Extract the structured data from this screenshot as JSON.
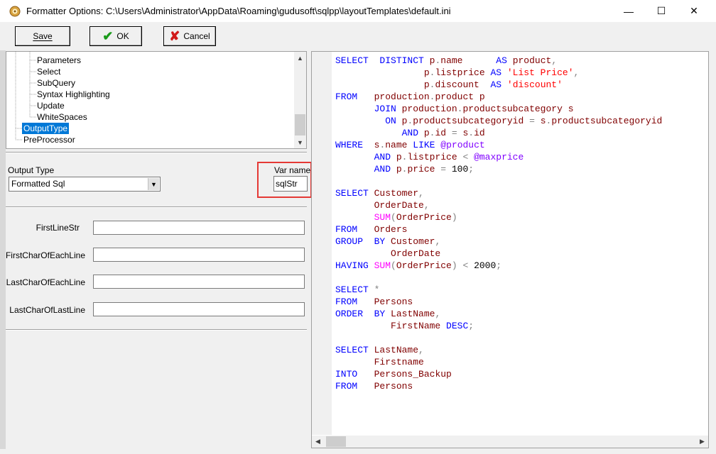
{
  "window": {
    "title": "Formatter Options: C:\\Users\\Administrator\\AppData\\Roaming\\gudusoft\\sqlpp\\layoutTemplates\\default.ini",
    "minimize_glyph": "—",
    "maximize_glyph": "☐",
    "close_glyph": "✕"
  },
  "toolbar": {
    "save_label": "Save",
    "ok_label": "OK",
    "cancel_label": "Cancel",
    "ok_glyph": "✔",
    "cancel_glyph": "✘"
  },
  "tree": {
    "items": [
      {
        "label": "Parameters",
        "selected": false
      },
      {
        "label": "Select",
        "selected": false
      },
      {
        "label": "SubQuery",
        "selected": false
      },
      {
        "label": "Syntax Highlighting",
        "selected": false
      },
      {
        "label": "Update",
        "selected": false
      },
      {
        "label": "WhiteSpaces",
        "selected": false
      },
      {
        "label": "OutputType",
        "selected": true
      },
      {
        "label": "PreProcessor",
        "selected": false
      }
    ]
  },
  "output": {
    "type_label": "Output Type",
    "type_value": "Formatted Sql",
    "varname_label": "Var name",
    "varname_value": "sqlStr"
  },
  "fields": [
    {
      "label": "FirstLineStr",
      "value": ""
    },
    {
      "label": "FirstCharOfEachLine",
      "value": ""
    },
    {
      "label": "LastCharOfEachLine",
      "value": ""
    },
    {
      "label": "LastCharOfLastLine",
      "value": ""
    }
  ],
  "colors": {
    "keyword": "#0000ff",
    "identifier": "#800000",
    "string": "#ff0000",
    "variable": "#8000ff",
    "function": "#ff00ff",
    "highlight_box": "#e53935",
    "selection": "#0078d7"
  },
  "editor": {
    "lines": [
      [
        [
          "kw",
          "SELECT"
        ],
        [
          "",
          "  "
        ],
        [
          "kw",
          "DISTINCT"
        ],
        [
          "",
          ""
        ],
        [
          "id",
          " p"
        ],
        [
          "op",
          "."
        ],
        [
          "id",
          "name"
        ],
        [
          "",
          "      "
        ],
        [
          "kw",
          "AS"
        ],
        [
          "id",
          " product"
        ],
        [
          "op",
          ","
        ]
      ],
      [
        [
          "",
          "                "
        ],
        [
          "id",
          "p"
        ],
        [
          "op",
          "."
        ],
        [
          "id",
          "listprice"
        ],
        [
          "",
          ""
        ],
        [
          "kw",
          " AS"
        ],
        [
          "str",
          " 'List Price'"
        ],
        [
          "op",
          ","
        ]
      ],
      [
        [
          "",
          "                "
        ],
        [
          "id",
          "p"
        ],
        [
          "op",
          "."
        ],
        [
          "id",
          "discount"
        ],
        [
          "",
          "  "
        ],
        [
          "kw",
          "AS"
        ],
        [
          "str",
          " 'discount'"
        ]
      ],
      [
        [
          "kw",
          "FROM"
        ],
        [
          "",
          "   "
        ],
        [
          "id",
          "production"
        ],
        [
          "op",
          "."
        ],
        [
          "id",
          "product"
        ],
        [
          "id",
          " p"
        ]
      ],
      [
        [
          "",
          "       "
        ],
        [
          "kw",
          "JOIN"
        ],
        [
          "id",
          " production"
        ],
        [
          "op",
          "."
        ],
        [
          "id",
          "productsubcategory"
        ],
        [
          "id",
          " s"
        ]
      ],
      [
        [
          "",
          "         "
        ],
        [
          "kw",
          "ON"
        ],
        [
          "id",
          " p"
        ],
        [
          "op",
          "."
        ],
        [
          "id",
          "productsubcategoryid"
        ],
        [
          "op",
          " = "
        ],
        [
          "id",
          "s"
        ],
        [
          "op",
          "."
        ],
        [
          "id",
          "productsubcategoryid"
        ]
      ],
      [
        [
          "",
          "            "
        ],
        [
          "kw",
          "AND"
        ],
        [
          "id",
          " p"
        ],
        [
          "op",
          "."
        ],
        [
          "id",
          "id"
        ],
        [
          "op",
          " = "
        ],
        [
          "id",
          "s"
        ],
        [
          "op",
          "."
        ],
        [
          "id",
          "id"
        ]
      ],
      [
        [
          "kw",
          "WHERE"
        ],
        [
          "",
          "  "
        ],
        [
          "id",
          "s"
        ],
        [
          "op",
          "."
        ],
        [
          "id",
          "name"
        ],
        [
          "kw",
          " LIKE"
        ],
        [
          "var",
          " @product"
        ]
      ],
      [
        [
          "",
          "       "
        ],
        [
          "kw",
          "AND"
        ],
        [
          "id",
          " p"
        ],
        [
          "op",
          "."
        ],
        [
          "id",
          "listprice"
        ],
        [
          "op",
          " < "
        ],
        [
          "var",
          "@maxprice"
        ]
      ],
      [
        [
          "",
          "       "
        ],
        [
          "kw",
          "AND"
        ],
        [
          "id",
          " p"
        ],
        [
          "op",
          "."
        ],
        [
          "id",
          "price"
        ],
        [
          "op",
          " = "
        ],
        [
          "num",
          "100"
        ],
        [
          "op",
          ";"
        ]
      ],
      [],
      [
        [
          "kw",
          "SELECT"
        ],
        [
          "id",
          " Customer"
        ],
        [
          "op",
          ","
        ]
      ],
      [
        [
          "",
          "       "
        ],
        [
          "id",
          "OrderDate"
        ],
        [
          "op",
          ","
        ]
      ],
      [
        [
          "",
          "       "
        ],
        [
          "fn",
          "SUM"
        ],
        [
          "op",
          "("
        ],
        [
          "id",
          "OrderPrice"
        ],
        [
          "op",
          ")"
        ]
      ],
      [
        [
          "kw",
          "FROM"
        ],
        [
          "",
          "   "
        ],
        [
          "id",
          "Orders"
        ]
      ],
      [
        [
          "kw",
          "GROUP"
        ],
        [
          "",
          "  "
        ],
        [
          "kw",
          "BY"
        ],
        [
          "id",
          " Customer"
        ],
        [
          "op",
          ","
        ]
      ],
      [
        [
          "",
          "          "
        ],
        [
          "id",
          "OrderDate"
        ]
      ],
      [
        [
          "kw",
          "HAVING"
        ],
        [
          "fn",
          " SUM"
        ],
        [
          "op",
          "("
        ],
        [
          "id",
          "OrderPrice"
        ],
        [
          "op",
          ")"
        ],
        [
          "op",
          " < "
        ],
        [
          "num",
          "2000"
        ],
        [
          "op",
          ";"
        ]
      ],
      [],
      [
        [
          "kw",
          "SELECT"
        ],
        [
          "op",
          " *"
        ]
      ],
      [
        [
          "kw",
          "FROM"
        ],
        [
          "",
          "   "
        ],
        [
          "id",
          "Persons"
        ]
      ],
      [
        [
          "kw",
          "ORDER"
        ],
        [
          "",
          "  "
        ],
        [
          "kw",
          "BY"
        ],
        [
          "id",
          " LastName"
        ],
        [
          "op",
          ","
        ]
      ],
      [
        [
          "",
          "          "
        ],
        [
          "id",
          "FirstName"
        ],
        [
          "kw",
          " DESC"
        ],
        [
          "op",
          ";"
        ]
      ],
      [],
      [
        [
          "kw",
          "SELECT"
        ],
        [
          "id",
          " LastName"
        ],
        [
          "op",
          ","
        ]
      ],
      [
        [
          "",
          "       "
        ],
        [
          "id",
          "Firstname"
        ]
      ],
      [
        [
          "kw",
          "INTO"
        ],
        [
          "",
          "   "
        ],
        [
          "id",
          "Persons_Backup"
        ]
      ],
      [
        [
          "kw",
          "FROM"
        ],
        [
          "",
          "   "
        ],
        [
          "id",
          "Persons"
        ]
      ]
    ]
  }
}
